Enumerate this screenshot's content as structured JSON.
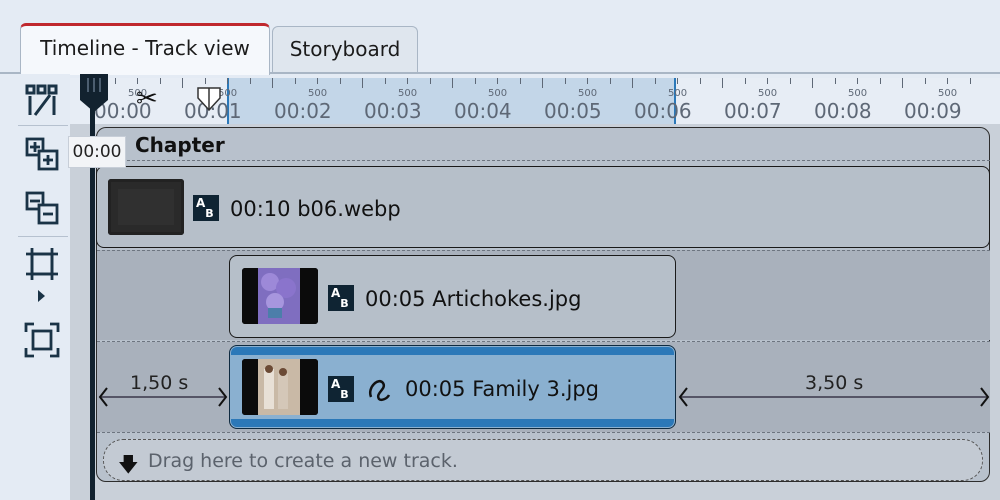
{
  "tabs": [
    {
      "label": "Timeline - Track view",
      "active": true
    },
    {
      "label": "Storyboard",
      "active": false
    }
  ],
  "toolbar": {
    "icons": [
      "track-tool-icon",
      "add-track-icon",
      "remove-track-icon",
      "fit-width-icon",
      "expand-icon",
      "fit-all-icon"
    ]
  },
  "ruler": {
    "labels": [
      "00:00",
      "00:01",
      "00:02",
      "00:03",
      "00:04",
      "00:05",
      "00:06",
      "00:07",
      "00:08",
      "00:09"
    ],
    "half_mark": "500",
    "playhead_time": "00:00"
  },
  "chapter": {
    "title": "Chapter"
  },
  "clips": [
    {
      "duration": "00:10",
      "name": "b06.webp",
      "transition": false
    },
    {
      "duration": "00:05",
      "name": "Artichokes.jpg",
      "transition": false
    },
    {
      "duration": "00:05",
      "name": "Family 3.jpg",
      "transition": true,
      "selected": true
    }
  ],
  "gaps": {
    "before": "1,50 s",
    "after": "3,50 s"
  },
  "new_track": {
    "text": "Drag here to create a new track."
  },
  "colors": {
    "accent": "#c0282e",
    "selection": "#2b78b8",
    "ruler_selection": "#c3d6e8"
  }
}
